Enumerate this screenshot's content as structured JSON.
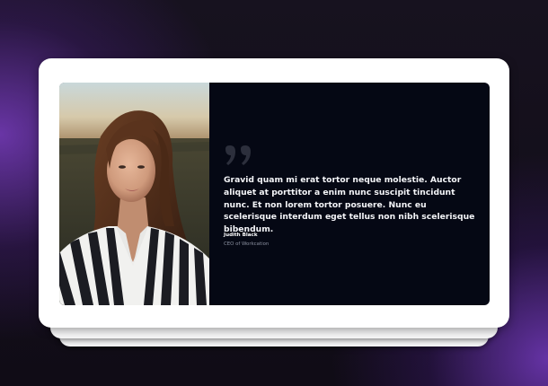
{
  "testimonial": {
    "quote_icon": "quote-marks-icon",
    "photo_subject": "portrait-photo",
    "quote": "Gravid quam mi erat tortor neque molestie. Auctor aliquet at porttitor a enim nunc suscipit tincidunt nunc. Et non lorem tortor posuere. Nunc eu scelerisque interdum eget tellus non nibh scelerisque bibendum.",
    "author_name": "Judith Black",
    "author_role": "CEO of Workcation"
  },
  "colors": {
    "card_background": "#050814",
    "frame": "#ffffff",
    "quote_icon": "#2c2f3c",
    "quote_text": "#f4f5f8",
    "role_text": "#8b90a0",
    "page_glow": "#7a3cc0"
  }
}
